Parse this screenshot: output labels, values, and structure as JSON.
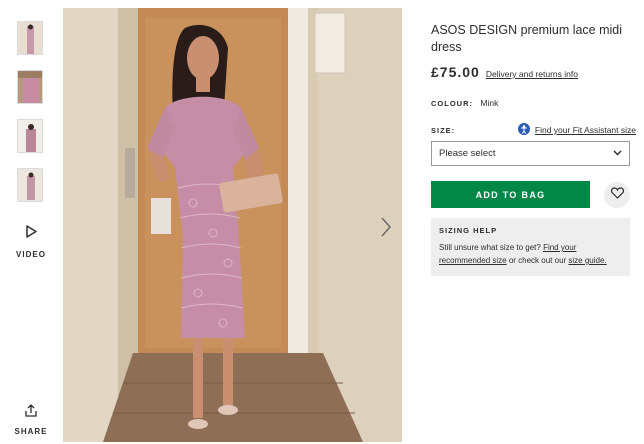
{
  "gallery": {
    "thumbnails": [
      "thumb-1",
      "thumb-2",
      "thumb-3",
      "thumb-4"
    ],
    "video_label": "VIDEO",
    "share_label": "SHARE",
    "icons": {
      "video": "play-icon",
      "share": "share-icon",
      "next": "chevron-right-icon"
    }
  },
  "product": {
    "title": "ASOS DESIGN premium lace midi dress",
    "price": "£75.00",
    "delivery_link": "Delivery and returns info",
    "colour_label": "COLOUR:",
    "colour_value": "Mink",
    "size_label": "SIZE:",
    "fit_assistant_link": "Find your Fit Assistant size",
    "size_select_value": "Please select",
    "add_to_bag": "ADD TO BAG"
  },
  "sizing_help": {
    "title": "SIZING HELP",
    "text_before": "Still unsure what size to get? ",
    "link_recommended": "Find your recommended size",
    "text_middle": " or check out our ",
    "link_guide": "size guide.",
    "text_end": ""
  },
  "colors": {
    "accent_green": "#018849",
    "dress": "#c58ea6",
    "panel_bg": "#eeeeee",
    "fit_icon": "#2d5bb3"
  }
}
